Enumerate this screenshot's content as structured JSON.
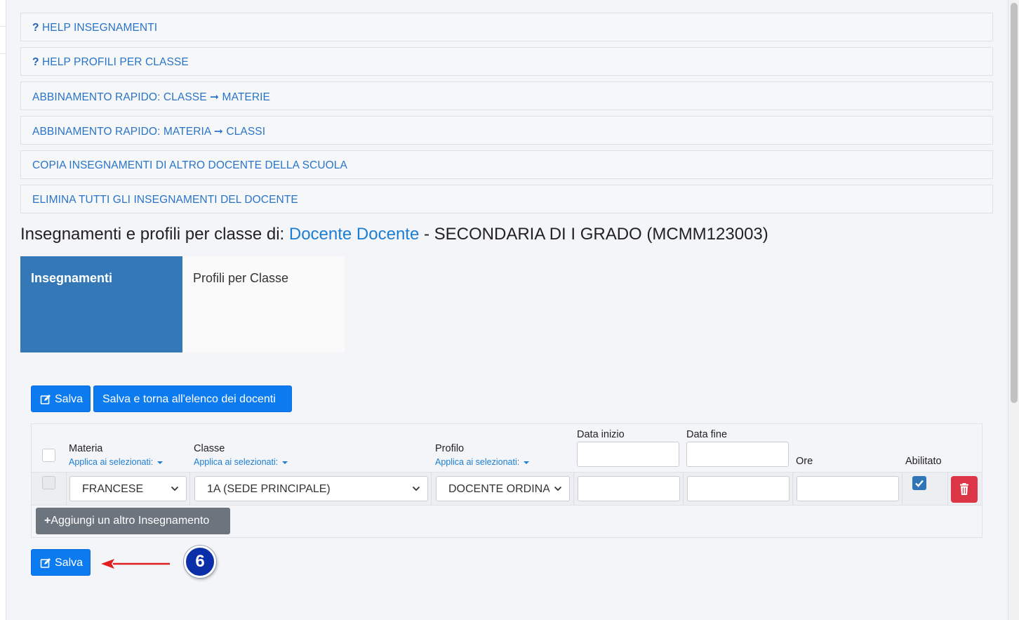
{
  "accordion": {
    "help_insegnamenti": "HELP INSEGNAMENTI",
    "help_profili": "HELP PROFILI PER CLASSE",
    "abbinamento_classe": "ABBINAMENTO RAPIDO: CLASSE ➞ MATERIE",
    "abbinamento_materia": "ABBINAMENTO RAPIDO: MATERIA ➞ CLASSI",
    "copia": "COPIA INSEGNAMENTI DI ALTRO DOCENTE DELLA SCUOLA",
    "elimina": "ELIMINA TUTTI GLI INSEGNAMENTI DEL DOCENTE",
    "help_mark": "?"
  },
  "title": {
    "prefix": "Insegnamenti e profili per classe di: ",
    "teacher": "Docente Docente",
    "suffix": " - SECONDARIA DI I GRADO (MCMM123003)"
  },
  "tabs": {
    "insegnamenti": "Insegnamenti",
    "profili": "Profili per Classe"
  },
  "toolbar": {
    "save": "Salva",
    "save_back": "Salva e torna all'elenco dei docenti"
  },
  "table": {
    "headers": {
      "materia": "Materia",
      "classe": "Classe",
      "profilo": "Profilo",
      "data_inizio": "Data inizio",
      "data_fine": "Data fine",
      "ore": "Ore",
      "abilitato": "Abilitato"
    },
    "apply_selected": "Applica ai selezionati:",
    "row": {
      "materia": "FRANCESE",
      "classe": "1A (SEDE PRINCIPALE)",
      "profilo": "DOCENTE ORDINARIO",
      "data_inizio": "",
      "data_fine": "",
      "ore": "",
      "abilitato": true
    },
    "add_button": "Aggiungi un altro Insegnamento"
  },
  "footer": {
    "save": "Salva",
    "step_badge": "6"
  },
  "colors": {
    "primary": "#0d7bf0",
    "tab_active": "#3578b8",
    "link": "#1b7ed4",
    "danger": "#dc3545",
    "secondary": "#6c757d",
    "annotation_arrow": "#e02020",
    "badge": "#0a2fa8"
  }
}
